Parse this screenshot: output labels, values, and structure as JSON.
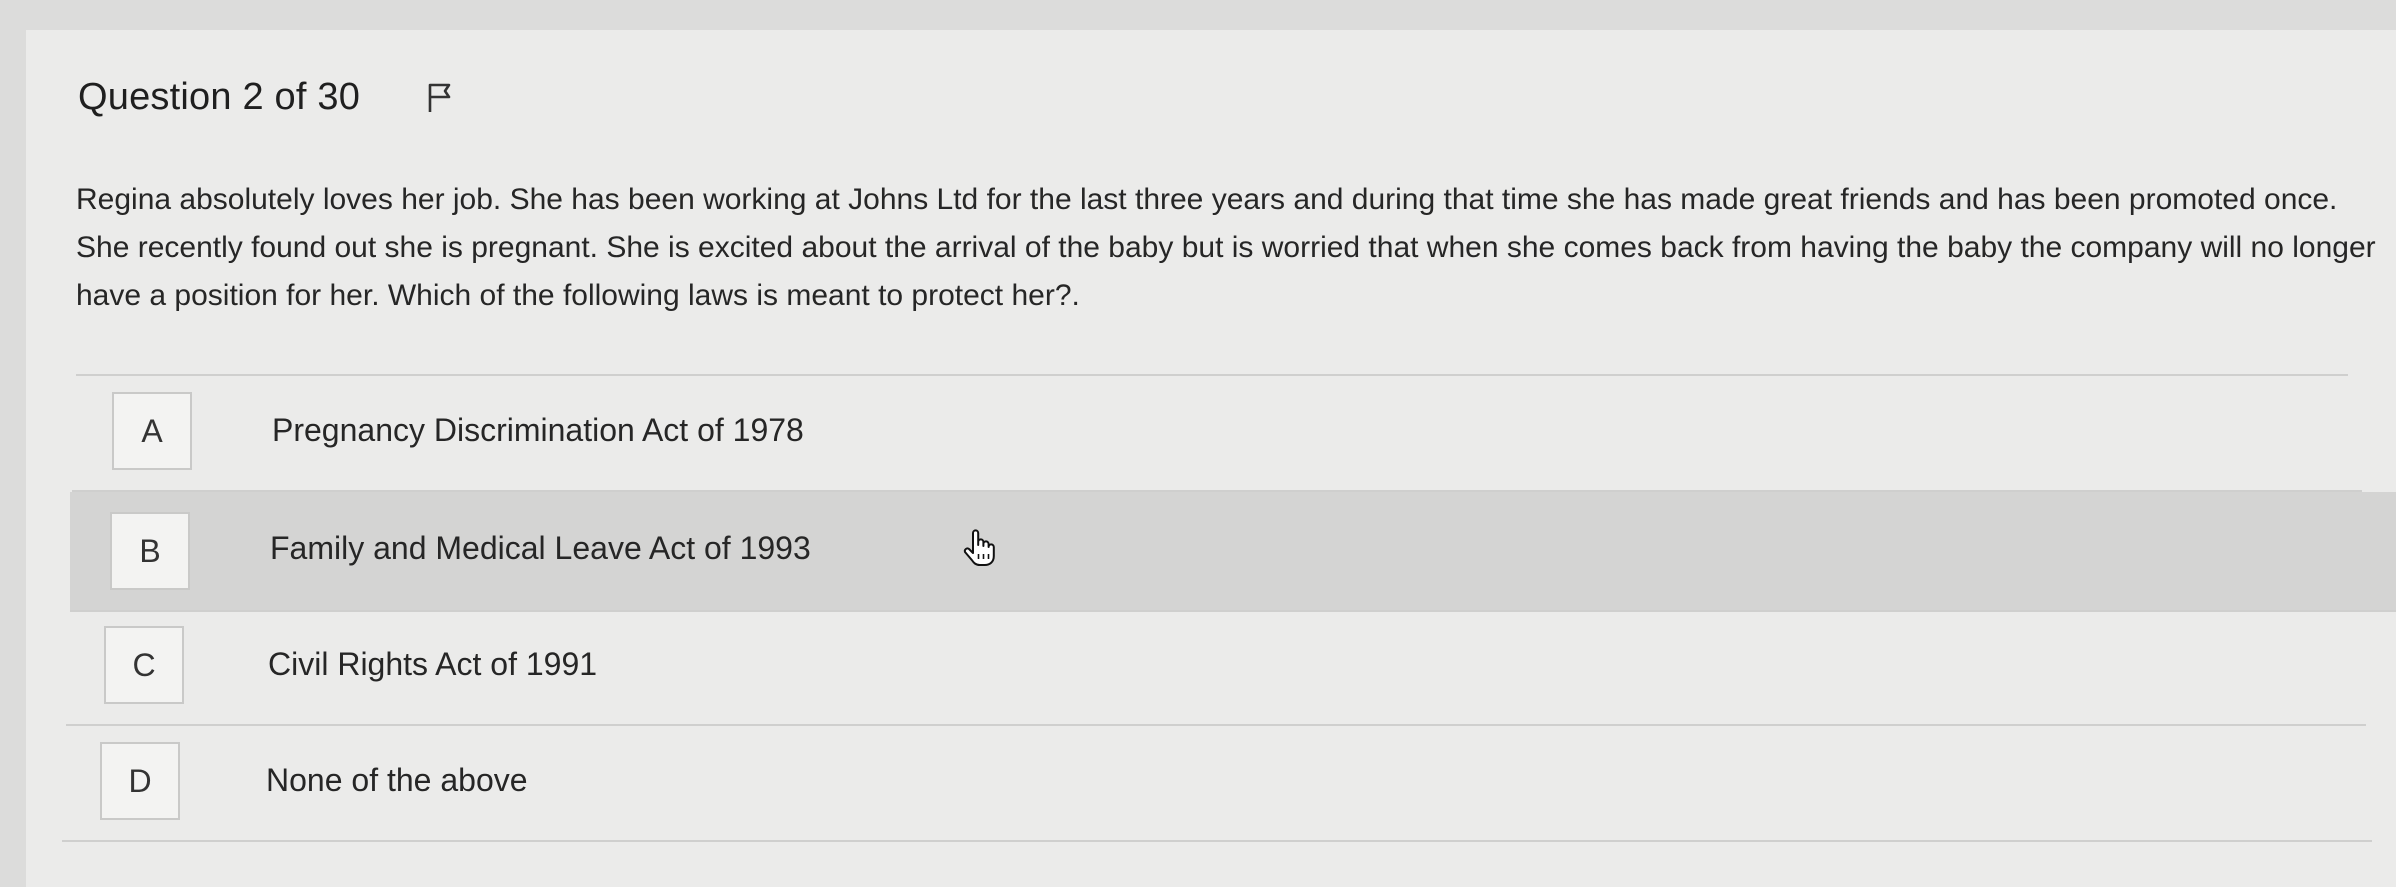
{
  "question": {
    "title": "Question 2 of 30",
    "prompt": "Regina absolutely loves her job. She has been working at Johns Ltd for the last three years and during that time she has made great friends and has been promoted once. She recently found out she is pregnant. She is excited about the arrival of the baby but is worried that when she comes back from having the baby the company will no longer have a position for her. Which of the following laws is meant to protect her?."
  },
  "options": [
    {
      "letter": "A",
      "text": "Pregnancy Discrimination Act of 1978"
    },
    {
      "letter": "B",
      "text": "Family and Medical Leave Act of 1993"
    },
    {
      "letter": "C",
      "text": "Civil Rights Act of 1991"
    },
    {
      "letter": "D",
      "text": "None of the above"
    }
  ],
  "icons": {
    "flag": "flag-icon",
    "cursor": "hand-pointer-icon"
  },
  "colors": {
    "background": "#ebebea",
    "hover_row": "#d4d4d3"
  }
}
